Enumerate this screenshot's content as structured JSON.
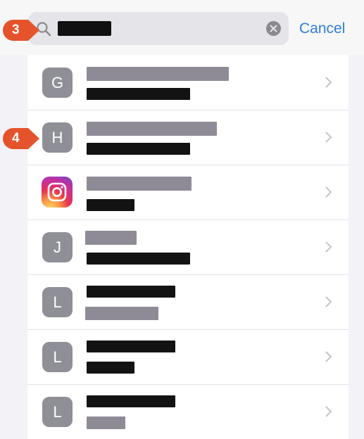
{
  "search": {
    "cancel_label": "Cancel"
  },
  "results": [
    {
      "avatar_letter": "G"
    },
    {
      "avatar_letter": "H"
    },
    {
      "avatar_letter": "",
      "app_icon": "instagram-icon"
    },
    {
      "avatar_letter": "J"
    },
    {
      "avatar_letter": "L"
    },
    {
      "avatar_letter": "L"
    },
    {
      "avatar_letter": "L"
    }
  ],
  "callouts": [
    {
      "label": "3"
    },
    {
      "label": "4"
    }
  ],
  "colors": {
    "accent": "#2f7fd9",
    "callout": "#e5532c",
    "avatar_gray": "#8f8f97"
  }
}
